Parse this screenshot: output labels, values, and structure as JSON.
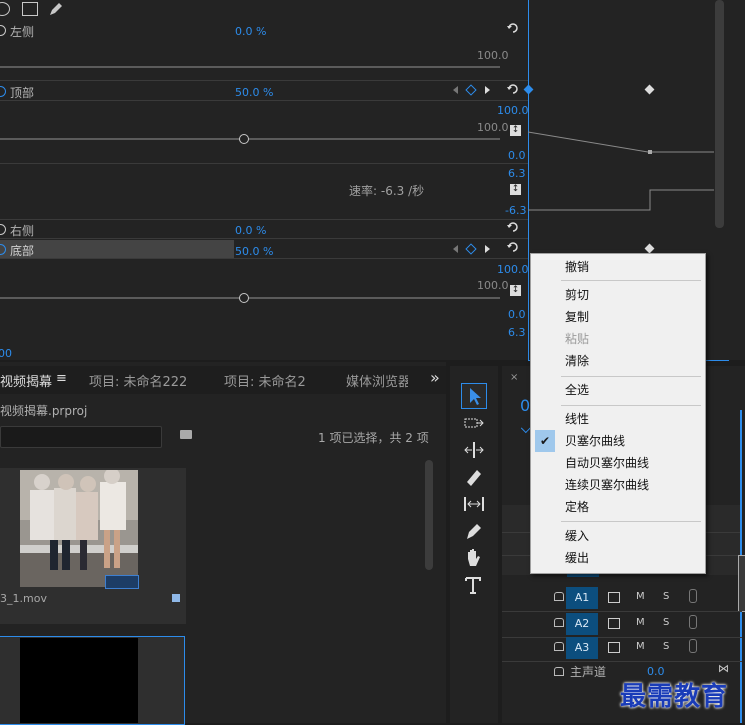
{
  "effect_controls": {
    "rows": [
      {
        "label": "左侧",
        "value": "0.0 %"
      },
      {
        "label": "顶部",
        "value": "50.0 %"
      },
      {
        "label": "右侧",
        "value": "0.0 %"
      },
      {
        "label": "底部",
        "value": "50.0 %"
      }
    ],
    "scale_100": "100.0",
    "graph_top_100": "100.0",
    "graph_zero": "0.0",
    "graph_pos": "6.3",
    "graph_neg": "-6.3",
    "speed": "速率: -6.3 /秒",
    "timecode_tail": "00"
  },
  "project_panel": {
    "tabs": [
      "视频揭幕",
      "项目: 未命名222",
      "项目: 未命名2",
      "媒体浏览器"
    ],
    "project_file": "视频揭幕.prproj",
    "selection_info": "1 项已选择，共 2 项",
    "clip_name": "3_1.mov",
    "more_icon": "»"
  },
  "timeline": {
    "timecode": "0",
    "tracks": [
      {
        "name": "A1",
        "m": "M",
        "s": "S"
      },
      {
        "name": "A2",
        "m": "M",
        "s": "S"
      },
      {
        "name": "A3",
        "m": "M",
        "s": "S"
      }
    ],
    "master_label": "主声道",
    "master_value": "0.0"
  },
  "context_menu": {
    "groups": [
      [
        {
          "label": "撤销",
          "enabled": true
        }
      ],
      [
        {
          "label": "剪切",
          "enabled": true
        },
        {
          "label": "复制",
          "enabled": true
        },
        {
          "label": "粘贴",
          "enabled": false
        },
        {
          "label": "清除",
          "enabled": true
        }
      ],
      [
        {
          "label": "全选",
          "enabled": true
        }
      ],
      [
        {
          "label": "线性",
          "enabled": true
        },
        {
          "label": "贝塞尔曲线",
          "enabled": true,
          "checked": true
        },
        {
          "label": "自动贝塞尔曲线",
          "enabled": true
        },
        {
          "label": "连续贝塞尔曲线",
          "enabled": true
        },
        {
          "label": "定格",
          "enabled": true
        }
      ],
      [
        {
          "label": "缓入",
          "enabled": true
        },
        {
          "label": "缓出",
          "enabled": true
        }
      ]
    ]
  },
  "watermark": "最需教育",
  "colors": {
    "accent": "#2d8ceb",
    "menu_bg": "#f0f0f0",
    "track_btn": "#0c4e7e"
  }
}
